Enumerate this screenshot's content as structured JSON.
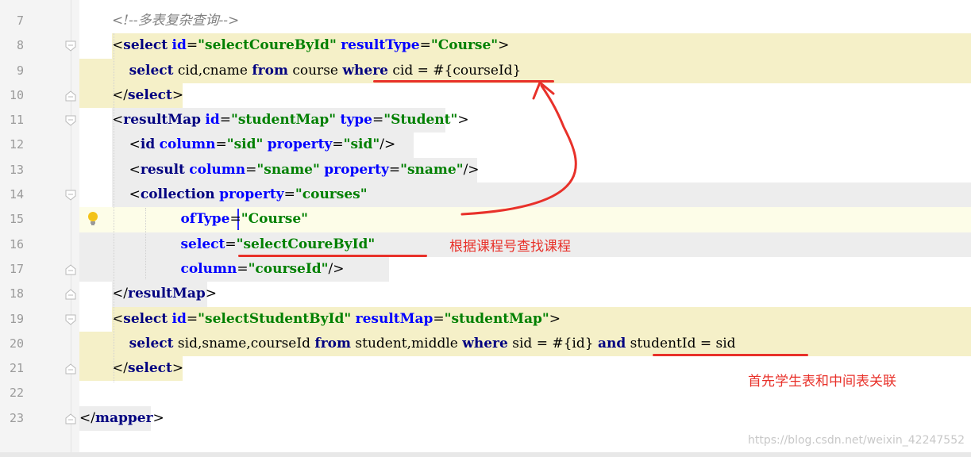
{
  "editor": {
    "line_numbers": [
      "7",
      "8",
      "9",
      "10",
      "11",
      "12",
      "13",
      "14",
      "15",
      "16",
      "17",
      "18",
      "19",
      "20",
      "21",
      "22",
      "23"
    ],
    "colors": {
      "tag": "#000080",
      "attr": "#0000ff",
      "string": "#008000",
      "comment": "#808080",
      "keyword": "#000080",
      "plain": "#000000",
      "highlight": "#f5f0c8",
      "current_line": "#fdfde8",
      "annotation": "#e8312a"
    },
    "lines": [
      {
        "segments": [
          {
            "t": "<!--多表复杂查询-->",
            "c": "comment",
            "i": true
          }
        ]
      },
      {
        "segments": [
          {
            "t": "<",
            "c": "plain"
          },
          {
            "t": "select",
            "c": "tag",
            "b": true
          },
          {
            "t": " ",
            "c": "plain"
          },
          {
            "t": "id",
            "c": "attr",
            "b": true
          },
          {
            "t": "=",
            "c": "plain"
          },
          {
            "t": "\"selectCoureById\"",
            "c": "string",
            "b": true
          },
          {
            "t": " ",
            "c": "plain"
          },
          {
            "t": "resultType",
            "c": "attr",
            "b": true
          },
          {
            "t": "=",
            "c": "plain"
          },
          {
            "t": "\"Course\"",
            "c": "string",
            "b": true
          },
          {
            "t": ">",
            "c": "plain"
          }
        ]
      },
      {
        "segments": [
          {
            "t": "    ",
            "c": "plain"
          },
          {
            "t": "select",
            "c": "keyword",
            "b": true
          },
          {
            "t": " cid,cname ",
            "c": "plain"
          },
          {
            "t": "from",
            "c": "keyword",
            "b": true
          },
          {
            "t": " course ",
            "c": "plain"
          },
          {
            "t": "where",
            "c": "keyword",
            "b": true
          },
          {
            "t": " cid = #{courseId}",
            "c": "plain"
          }
        ]
      },
      {
        "segments": [
          {
            "t": "</",
            "c": "plain"
          },
          {
            "t": "select",
            "c": "tag",
            "b": true
          },
          {
            "t": ">",
            "c": "plain"
          }
        ]
      },
      {
        "segments": [
          {
            "t": "<",
            "c": "plain"
          },
          {
            "t": "resultMap",
            "c": "tag",
            "b": true
          },
          {
            "t": " ",
            "c": "plain"
          },
          {
            "t": "id",
            "c": "attr",
            "b": true
          },
          {
            "t": "=",
            "c": "plain"
          },
          {
            "t": "\"studentMap\"",
            "c": "string",
            "b": true
          },
          {
            "t": " ",
            "c": "plain"
          },
          {
            "t": "type",
            "c": "attr",
            "b": true
          },
          {
            "t": "=",
            "c": "plain"
          },
          {
            "t": "\"Student\"",
            "c": "string",
            "b": true
          },
          {
            "t": ">",
            "c": "plain"
          }
        ]
      },
      {
        "segments": [
          {
            "t": "    <",
            "c": "plain"
          },
          {
            "t": "id",
            "c": "tag",
            "b": true
          },
          {
            "t": " ",
            "c": "plain"
          },
          {
            "t": "column",
            "c": "attr",
            "b": true
          },
          {
            "t": "=",
            "c": "plain"
          },
          {
            "t": "\"sid\"",
            "c": "string",
            "b": true
          },
          {
            "t": " ",
            "c": "plain"
          },
          {
            "t": "property",
            "c": "attr",
            "b": true
          },
          {
            "t": "=",
            "c": "plain"
          },
          {
            "t": "\"sid\"",
            "c": "string",
            "b": true
          },
          {
            "t": "/>",
            "c": "plain"
          }
        ]
      },
      {
        "segments": [
          {
            "t": "    <",
            "c": "plain"
          },
          {
            "t": "result",
            "c": "tag",
            "b": true
          },
          {
            "t": " ",
            "c": "plain"
          },
          {
            "t": "column",
            "c": "attr",
            "b": true
          },
          {
            "t": "=",
            "c": "plain"
          },
          {
            "t": "\"sname\"",
            "c": "string",
            "b": true
          },
          {
            "t": " ",
            "c": "plain"
          },
          {
            "t": "property",
            "c": "attr",
            "b": true
          },
          {
            "t": "=",
            "c": "plain"
          },
          {
            "t": "\"sname\"",
            "c": "string",
            "b": true
          },
          {
            "t": "/>",
            "c": "plain"
          }
        ]
      },
      {
        "segments": [
          {
            "t": "    <",
            "c": "plain"
          },
          {
            "t": "collection",
            "c": "tag",
            "b": true
          },
          {
            "t": " ",
            "c": "plain"
          },
          {
            "t": "property",
            "c": "attr",
            "b": true
          },
          {
            "t": "=",
            "c": "plain"
          },
          {
            "t": "\"courses\"",
            "c": "string",
            "b": true
          }
        ]
      },
      {
        "segments": [
          {
            "t": "                ",
            "c": "plain"
          },
          {
            "t": "ofType",
            "c": "attr",
            "b": true
          },
          {
            "t": "=",
            "c": "plain"
          },
          {
            "t": "\"Course\"",
            "c": "string",
            "b": true
          }
        ]
      },
      {
        "segments": [
          {
            "t": "                ",
            "c": "plain"
          },
          {
            "t": "select",
            "c": "attr",
            "b": true
          },
          {
            "t": "=",
            "c": "plain"
          },
          {
            "t": "\"selectCoureById\"",
            "c": "string",
            "b": true
          }
        ]
      },
      {
        "segments": [
          {
            "t": "                ",
            "c": "plain"
          },
          {
            "t": "column",
            "c": "attr",
            "b": true
          },
          {
            "t": "=",
            "c": "plain"
          },
          {
            "t": "\"courseId\"",
            "c": "string",
            "b": true
          },
          {
            "t": "/>",
            "c": "plain"
          }
        ]
      },
      {
        "segments": [
          {
            "t": "</",
            "c": "plain"
          },
          {
            "t": "resultMap",
            "c": "tag",
            "b": true
          },
          {
            "t": ">",
            "c": "plain"
          }
        ]
      },
      {
        "segments": [
          {
            "t": "<",
            "c": "plain"
          },
          {
            "t": "select",
            "c": "tag",
            "b": true
          },
          {
            "t": " ",
            "c": "plain"
          },
          {
            "t": "id",
            "c": "attr",
            "b": true
          },
          {
            "t": "=",
            "c": "plain"
          },
          {
            "t": "\"selectStudentById\"",
            "c": "string",
            "b": true
          },
          {
            "t": " ",
            "c": "plain"
          },
          {
            "t": "resultMap",
            "c": "attr",
            "b": true
          },
          {
            "t": "=",
            "c": "plain"
          },
          {
            "t": "\"studentMap\"",
            "c": "string",
            "b": true
          },
          {
            "t": ">",
            "c": "plain"
          }
        ]
      },
      {
        "segments": [
          {
            "t": "    ",
            "c": "plain"
          },
          {
            "t": "select",
            "c": "keyword",
            "b": true
          },
          {
            "t": " sid,sname,courseId ",
            "c": "plain"
          },
          {
            "t": "from",
            "c": "keyword",
            "b": true
          },
          {
            "t": " student,middle ",
            "c": "plain"
          },
          {
            "t": "where",
            "c": "keyword",
            "b": true
          },
          {
            "t": " sid = #{id} ",
            "c": "plain"
          },
          {
            "t": "and",
            "c": "keyword",
            "b": true
          },
          {
            "t": " studentId = sid",
            "c": "plain"
          }
        ]
      },
      {
        "segments": [
          {
            "t": "</",
            "c": "plain"
          },
          {
            "t": "select",
            "c": "tag",
            "b": true
          },
          {
            "t": ">",
            "c": "plain"
          }
        ]
      },
      {
        "segments": []
      },
      {
        "segments": [
          {
            "t": "</",
            "c": "plain"
          },
          {
            "t": "mapper",
            "c": "tag",
            "b": true
          },
          {
            "t": ">",
            "c": "plain"
          }
        ]
      }
    ]
  },
  "annotations": {
    "select_note": "根据课程号查找课程",
    "join_note": "首先学生表和中间表关联"
  },
  "watermark": "https://blog.csdn.net/weixin_42247552",
  "icons": {
    "bulb": "lightbulb-icon",
    "fold": "fold-marker-icon"
  }
}
